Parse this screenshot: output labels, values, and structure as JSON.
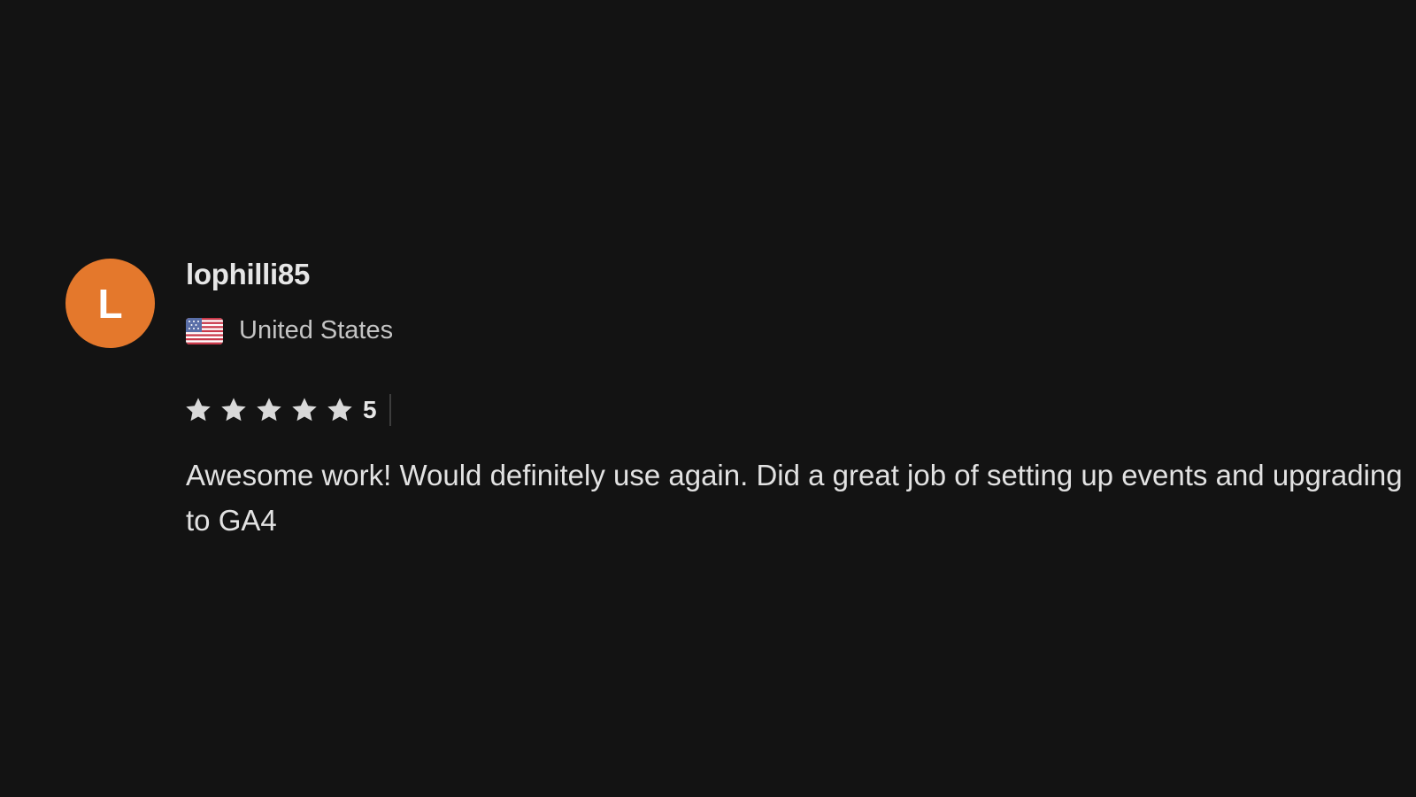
{
  "review": {
    "avatar_initial": "L",
    "avatar_color": "#e4782c",
    "username": "lophilli85",
    "country": "United States",
    "flag_icon": "us-flag-icon",
    "star_icon": "star-icon",
    "star_color": "#d9d9d9",
    "star_count": 5,
    "rating": "5",
    "text": "Awesome work! Would definitely use again. Did a great job of setting up events and upgrading to GA4"
  }
}
